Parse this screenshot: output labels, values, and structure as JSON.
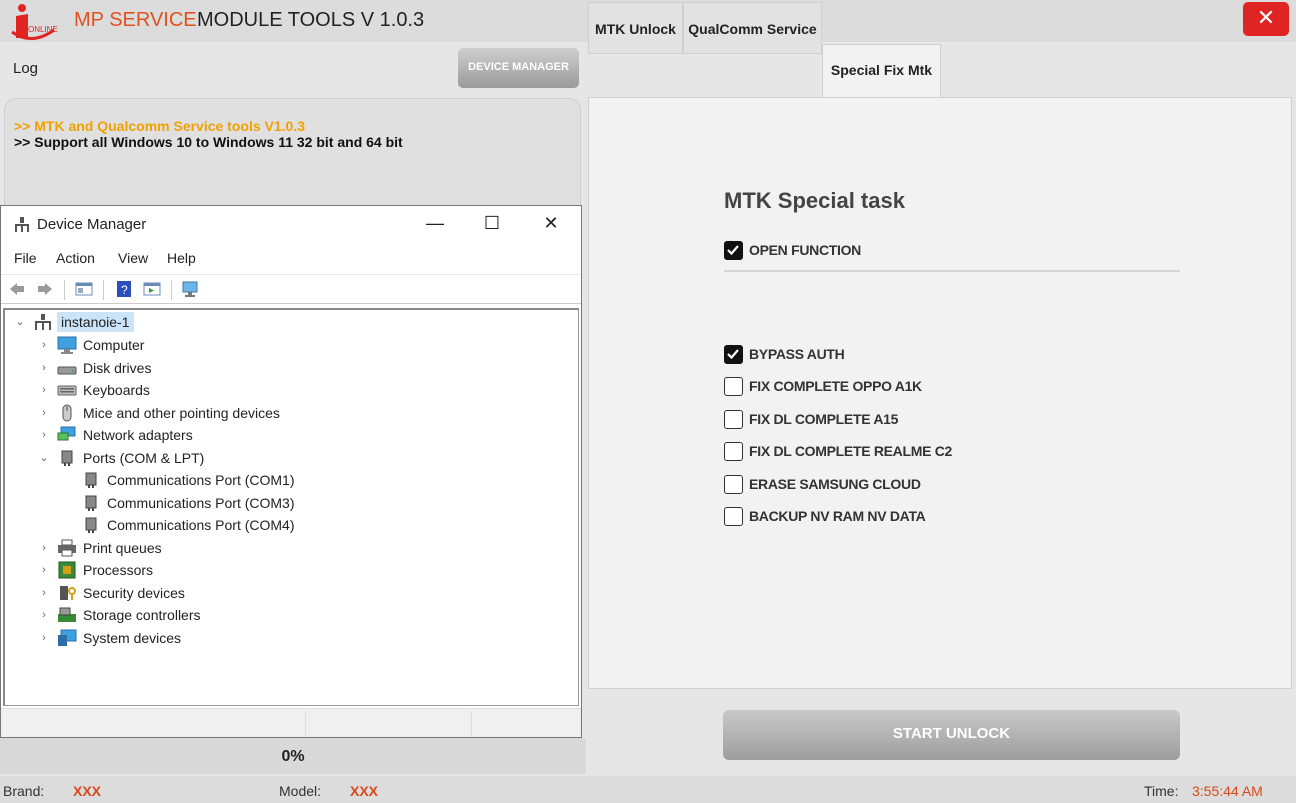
{
  "app": {
    "brand": "MP SERVICE",
    "title": "MODULE TOOLS V 1.0.3",
    "logo_text": "ONLINE",
    "close_glyph": "✕"
  },
  "left": {
    "log_label": "Log",
    "device_manager_button": "DEVICE MANAGER",
    "log_lines": [
      ">> MTK and Qualcomm Service tools V1.0.3",
      ">> Support all Windows 10 to Windows 11 32 bit and 64 bit"
    ],
    "progress": "0%"
  },
  "device_manager": {
    "title": "Device Manager",
    "controls": {
      "minimize": "—",
      "maximize": "☐",
      "close": "✕"
    },
    "menu": [
      "File",
      "Action",
      "View",
      "Help"
    ],
    "tree": {
      "root": "instanoie-1",
      "items": [
        {
          "label": "Computer",
          "icon": "computer-icon",
          "expanded": false
        },
        {
          "label": "Disk drives",
          "icon": "disk-drive-icon",
          "expanded": false
        },
        {
          "label": "Keyboards",
          "icon": "keyboard-icon",
          "expanded": false
        },
        {
          "label": "Mice and other pointing devices",
          "icon": "mouse-icon",
          "expanded": false
        },
        {
          "label": "Network adapters",
          "icon": "network-icon",
          "expanded": false
        },
        {
          "label": "Ports (COM & LPT)",
          "icon": "port-icon",
          "expanded": true
        },
        {
          "label": "Communications Port (COM1)",
          "icon": "port-icon",
          "child": true
        },
        {
          "label": "Communications Port (COM3)",
          "icon": "port-icon",
          "child": true
        },
        {
          "label": "Communications Port (COM4)",
          "icon": "port-icon",
          "child": true
        },
        {
          "label": "Print queues",
          "icon": "printer-icon",
          "expanded": false
        },
        {
          "label": "Processors",
          "icon": "processor-icon",
          "expanded": false
        },
        {
          "label": "Security devices",
          "icon": "security-icon",
          "expanded": false
        },
        {
          "label": "Storage controllers",
          "icon": "storage-icon",
          "expanded": false
        },
        {
          "label": "System devices",
          "icon": "system-icon",
          "expanded": false
        }
      ]
    }
  },
  "tabs": [
    {
      "label": "MTK Unlock",
      "active": false
    },
    {
      "label": "QualComm Service",
      "active": false
    },
    {
      "label": "Special Fix Mtk",
      "active": true
    }
  ],
  "panel": {
    "title": "MTK Special task",
    "open_function": {
      "label": "OPEN FUNCTION",
      "checked": true
    },
    "options": [
      {
        "label": "BYPASS AUTH",
        "checked": true
      },
      {
        "label": "FIX COMPLETE OPPO A1K",
        "checked": false
      },
      {
        "label": "FIX DL COMPLETE A15",
        "checked": false
      },
      {
        "label": "FIX DL COMPLETE REALME C2",
        "checked": false
      },
      {
        "label": "ERASE SAMSUNG CLOUD",
        "checked": false
      },
      {
        "label": "BACKUP NV RAM NV DATA",
        "checked": false
      }
    ],
    "start_button": "START UNLOCK"
  },
  "footer": {
    "brand_label": "Brand:",
    "brand_value": "XXX",
    "model_label": "Model:",
    "model_value": "XXX",
    "time_label": "Time:",
    "time_value": "3:55:44 AM"
  },
  "colors": {
    "accent": "#e0521d",
    "log_highlight": "#f0a000",
    "close_red": "#e02424"
  }
}
